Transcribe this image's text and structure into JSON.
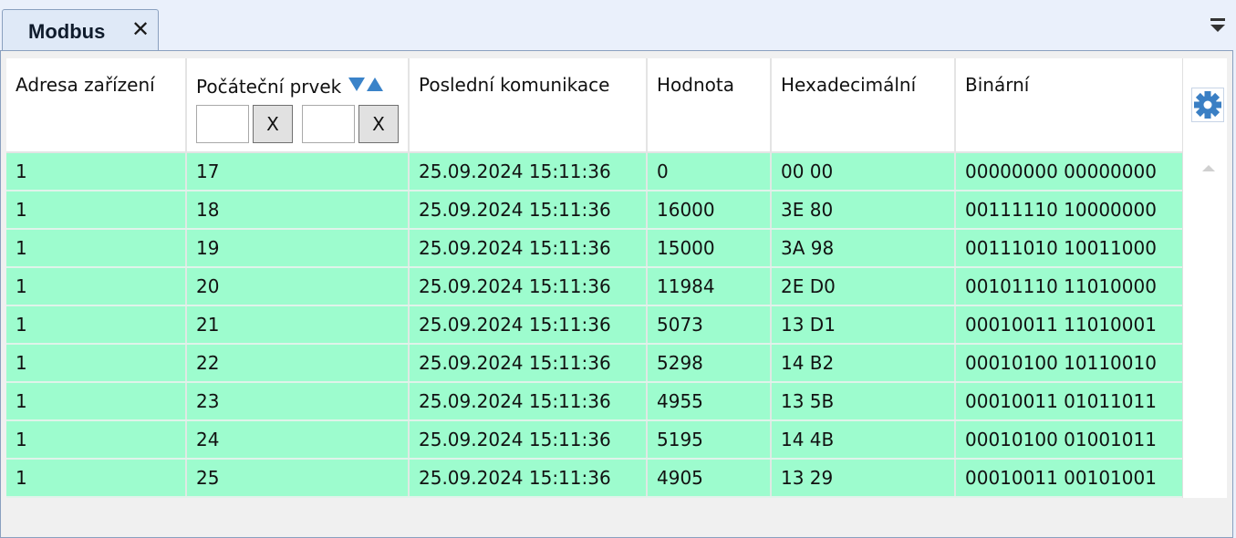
{
  "tab": {
    "title": "Modbus",
    "close_glyph": "✕",
    "menu_icon": "dropdown-menu-icon"
  },
  "colors": {
    "row_bg": "#9dfcce",
    "accent": "#3a83c9",
    "tab_bg": "#dfe9f7"
  },
  "table": {
    "columns": [
      "Adresa zařízení",
      "Počáteční prvek",
      "Poslední komunikace",
      "Hodnota",
      "Hexadecimální",
      "Binární"
    ],
    "filter": {
      "from_value": "",
      "to_value": "",
      "clear_label": "X"
    },
    "rows": [
      [
        "1",
        "17",
        "25.09.2024 15:11:36",
        "0",
        "00 00",
        "00000000 00000000"
      ],
      [
        "1",
        "18",
        "25.09.2024 15:11:36",
        "16000",
        "3E 80",
        "00111110 10000000"
      ],
      [
        "1",
        "19",
        "25.09.2024 15:11:36",
        "15000",
        "3A 98",
        "00111010 10011000"
      ],
      [
        "1",
        "20",
        "25.09.2024 15:11:36",
        "11984",
        "2E D0",
        "00101110 11010000"
      ],
      [
        "1",
        "21",
        "25.09.2024 15:11:36",
        "5073",
        "13 D1",
        "00010011 11010001"
      ],
      [
        "1",
        "22",
        "25.09.2024 15:11:36",
        "5298",
        "14 B2",
        "00010100 10110010"
      ],
      [
        "1",
        "23",
        "25.09.2024 15:11:36",
        "4955",
        "13 5B",
        "00010011 01011011"
      ],
      [
        "1",
        "24",
        "25.09.2024 15:11:36",
        "5195",
        "14 4B",
        "00010100 01001011"
      ],
      [
        "1",
        "25",
        "25.09.2024 15:11:36",
        "4905",
        "13 29",
        "00010011 00101001"
      ]
    ]
  },
  "settings": {
    "icon": "gear-icon"
  }
}
